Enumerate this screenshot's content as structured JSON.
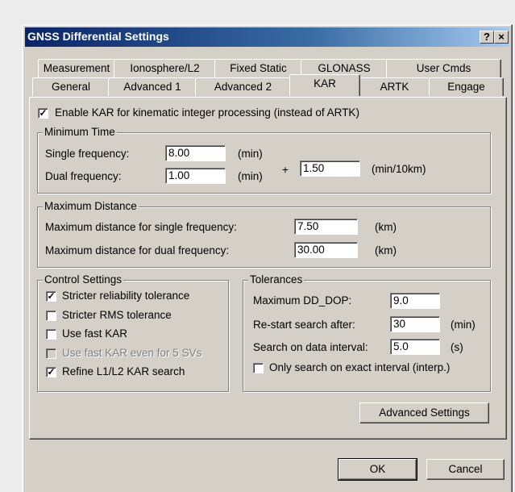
{
  "window": {
    "title": "GNSS Differential Settings",
    "help_button": "?",
    "close_button": "×"
  },
  "tabs_row1": [
    "Measurement",
    "Ionosphere/L2",
    "Fixed Static",
    "GLONASS",
    "User Cmds"
  ],
  "tabs_row2": [
    "General",
    "Advanced 1",
    "Advanced 2",
    "KAR",
    "ARTK",
    "Engage"
  ],
  "active_tab": "KAR",
  "enable_kar": {
    "checked": true,
    "label": "Enable KAR for kinematic integer processing (instead of ARTK)"
  },
  "minimum_time": {
    "title": "Minimum Time",
    "single_label": "Single frequency:",
    "single_value": "8.00",
    "single_unit": "(min)",
    "dual_label": "Dual frequency:",
    "dual_value": "1.00",
    "dual_unit": "(min)",
    "plus": "+",
    "extra_value": "1.50",
    "extra_unit": "(min/10km)"
  },
  "maximum_distance": {
    "title": "Maximum Distance",
    "single_label": "Maximum distance for single frequency:",
    "single_value": "7.50",
    "single_unit": "(km)",
    "dual_label": "Maximum distance for dual frequency:",
    "dual_value": "30.00",
    "dual_unit": "(km)"
  },
  "control_settings": {
    "title": "Control Settings",
    "items": [
      {
        "label": "Stricter reliability tolerance",
        "checked": true,
        "disabled": false
      },
      {
        "label": "Stricter RMS tolerance",
        "checked": false,
        "disabled": false
      },
      {
        "label": "Use fast KAR",
        "checked": false,
        "disabled": false
      },
      {
        "label": "Use fast KAR even for 5 SVs",
        "checked": false,
        "disabled": true
      },
      {
        "label": "Refine L1/L2 KAR search",
        "checked": true,
        "disabled": false
      }
    ]
  },
  "tolerances": {
    "title": "Tolerances",
    "dd_dop_label": "Maximum DD_DOP:",
    "dd_dop_value": "9.0",
    "restart_label": "Re-start search after:",
    "restart_value": "30",
    "restart_unit": "(min)",
    "interval_label": "Search on data interval:",
    "interval_value": "5.0",
    "interval_unit": "(s)",
    "exact_label": "Only search on exact interval (interp.)",
    "exact_checked": false
  },
  "advanced_settings_label": "Advanced Settings",
  "ok_label": "OK",
  "cancel_label": "Cancel"
}
